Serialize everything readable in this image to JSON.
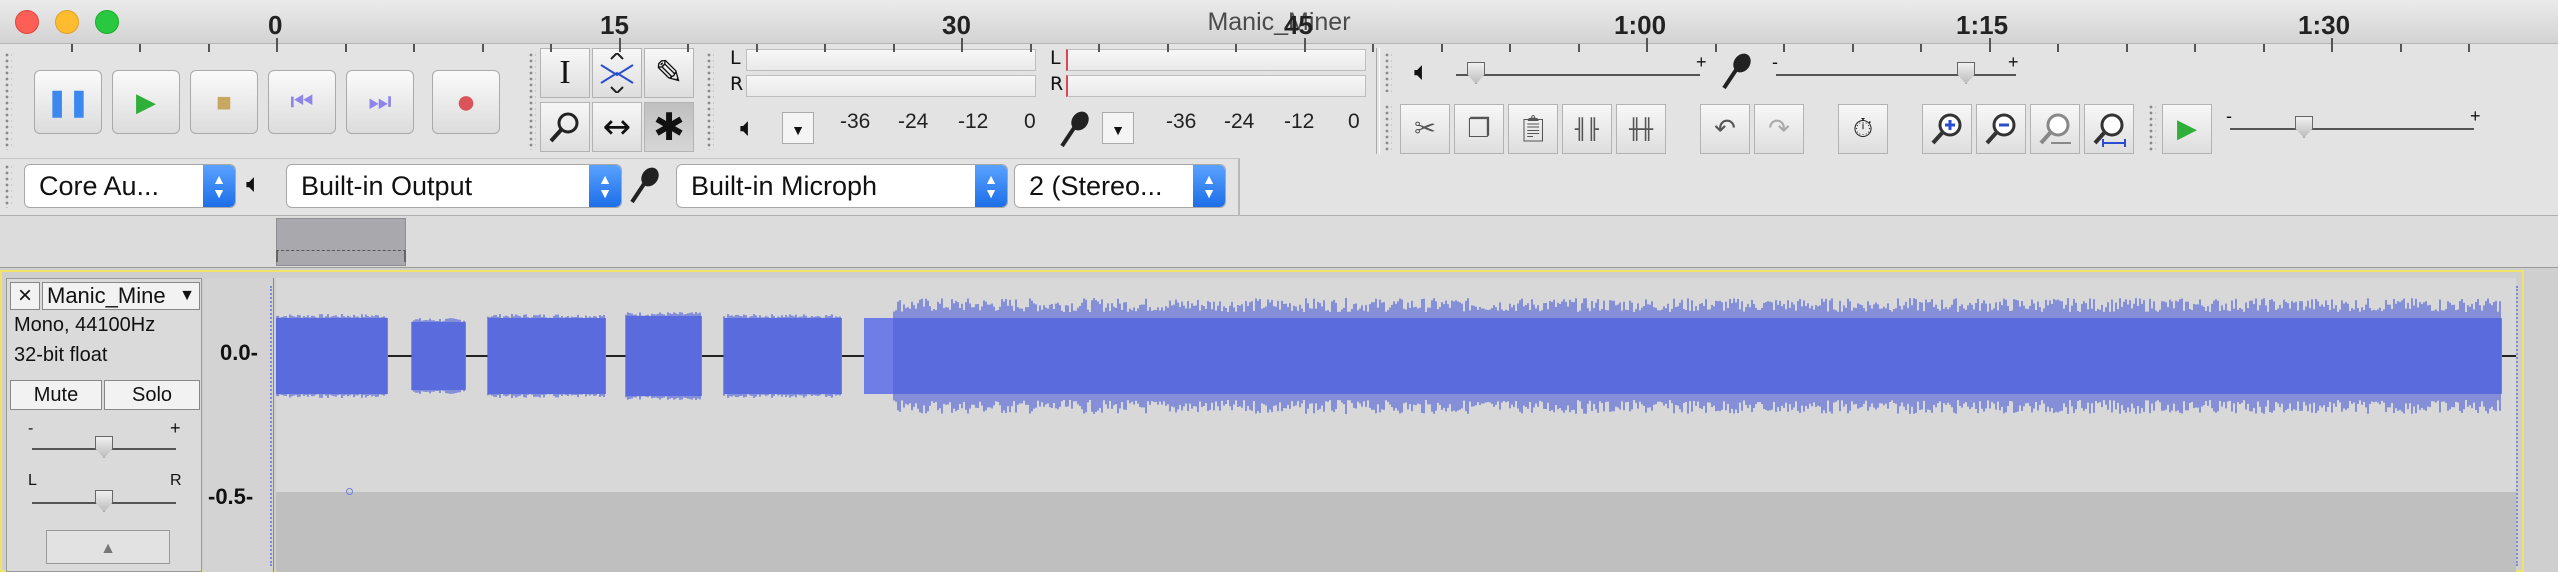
{
  "window": {
    "title": "Manic_Miner"
  },
  "colors": {
    "close": "#fd5f57",
    "minimize": "#febc2e",
    "zoom": "#28c840",
    "waveform": "#6f7ee6",
    "waveform_dark": "#4d5fd8",
    "accent": "#2a7cf2"
  },
  "transport": {
    "pause": "pause-icon",
    "play": "play-icon",
    "stop": "stop-icon",
    "skip_start": "skip-to-start-icon",
    "skip_end": "skip-to-end-icon",
    "record": "record-icon"
  },
  "tools": {
    "select": "I",
    "envelope": "envelope-icon",
    "draw": "✎",
    "zoom": "zoom-icon",
    "timeshift": "↔",
    "multi": "✱"
  },
  "meters": {
    "playback": {
      "channels": [
        "L",
        "R"
      ],
      "ticks": [
        "-36",
        "-24",
        "-12",
        "0"
      ]
    },
    "record": {
      "channels": [
        "L",
        "R"
      ],
      "ticks": [
        "-36",
        "-24",
        "-12",
        "0"
      ]
    }
  },
  "mixer": {
    "minus": "-",
    "plus": "+",
    "output_level": 0.05,
    "input_level": 0.82
  },
  "play_at_speed": {
    "minus": "-",
    "plus": "+",
    "level": 0.3
  },
  "devices": {
    "host": "Core Au...",
    "output": "Built-in Output",
    "input": "Built-in Microph",
    "channels": "2 (Stereo..."
  },
  "ruler": {
    "labels": [
      "0",
      "15",
      "30",
      "45",
      "1:00",
      "1:15",
      "1:30"
    ]
  },
  "track": {
    "name": "Manic_Mine",
    "info1": "Mono, 44100Hz",
    "info2": "32-bit float",
    "mute": "Mute",
    "solo": "Solo",
    "gain_minus": "-",
    "gain_plus": "+",
    "pan_left": "L",
    "pan_right": "R",
    "gain": 0.5,
    "pan": 0.5
  },
  "vertical_scale": {
    "labels": [
      "0.0-",
      "-0.5-"
    ]
  }
}
